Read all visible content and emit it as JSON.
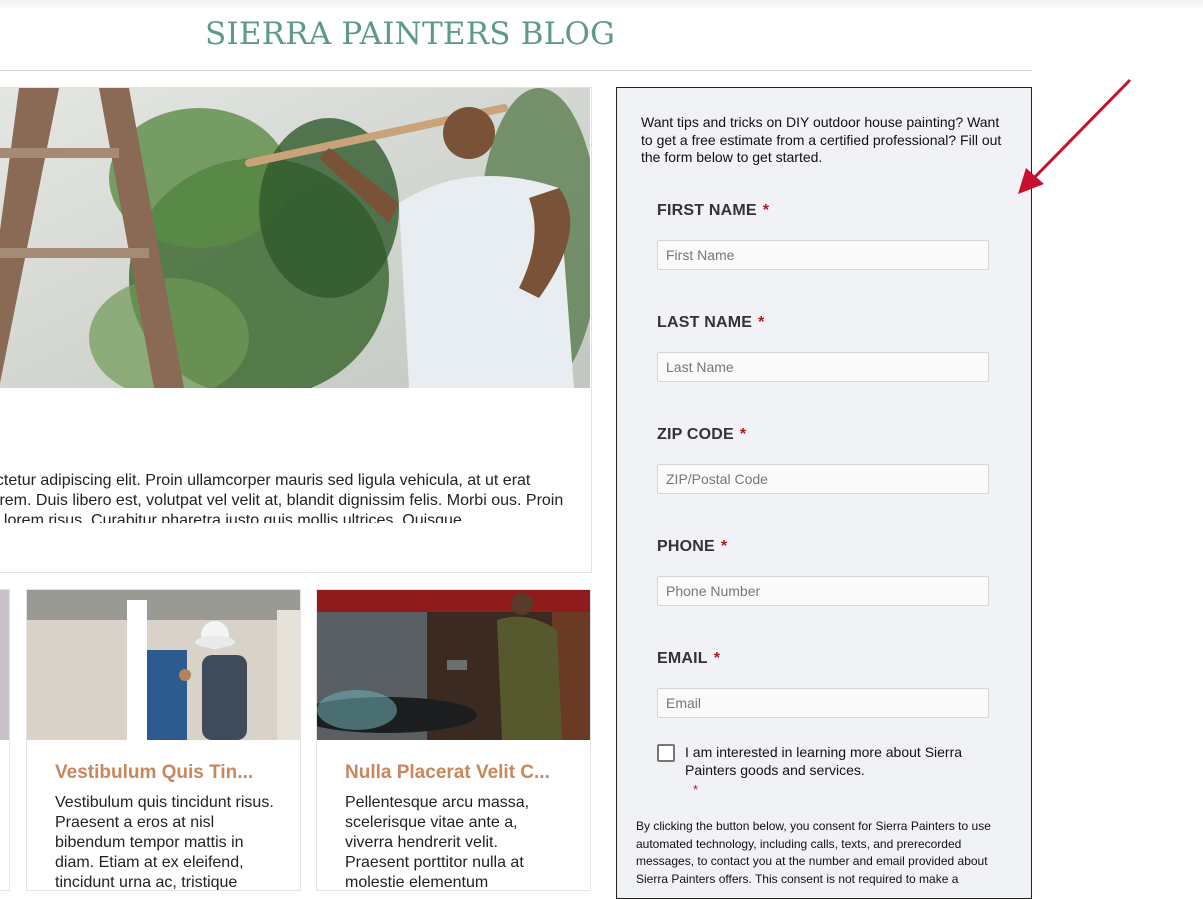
{
  "site": {
    "title": "SIERRA PAINTERS BLOG"
  },
  "feature": {
    "excerpt": "ectetur adipiscing elit. Proin ullamcorper mauris sed ligula vehicula, at ut erat lorem. Duis libero est, volutpat vel velit at, blandit dignissim felis. Morbi ous. Proin id lorem risus. Curabitur pharetra justo quis mollis ultrices. Quisque"
  },
  "cards": [
    {
      "title": "Vestibulum Quis Tin...",
      "body": "Vestibulum quis tincidunt risus. Praesent a eros at nisl bibendum tempor mattis in diam. Etiam at ex eleifend, tincidunt urna ac, tristique"
    },
    {
      "title": "Nulla Placerat Velit C...",
      "body": "Pellentesque arcu massa, scelerisque vitae ante a, viverra hendrerit velit. Praesent porttitor nulla at molestie elementum"
    }
  ],
  "form": {
    "intro": "Want tips and tricks on DIY outdoor house painting? Want to get a free estimate from a certified professional? Fill out the form below to get started.",
    "required_mark": "*",
    "fields": [
      {
        "label": "FIRST NAME",
        "placeholder": "First Name"
      },
      {
        "label": "LAST NAME",
        "placeholder": "Last Name"
      },
      {
        "label": "ZIP CODE",
        "placeholder": "ZIP/Postal Code"
      },
      {
        "label": "PHONE",
        "placeholder": "Phone Number"
      },
      {
        "label": "EMAIL",
        "placeholder": "Email"
      }
    ],
    "checkbox_label": "I am interested in learning more about Sierra Painters goods and services.",
    "consent": "By clicking the button below, you consent for Sierra Painters to use automated technology, including calls, texts, and prerecorded messages, to contact you at the number and email provided about Sierra Painters offers. This consent is not required to make a"
  },
  "colors": {
    "title_green": "#5e9b87",
    "card_title_orange": "#c9875d",
    "required_red": "#b0191e",
    "arrow_red": "#c8102e"
  }
}
